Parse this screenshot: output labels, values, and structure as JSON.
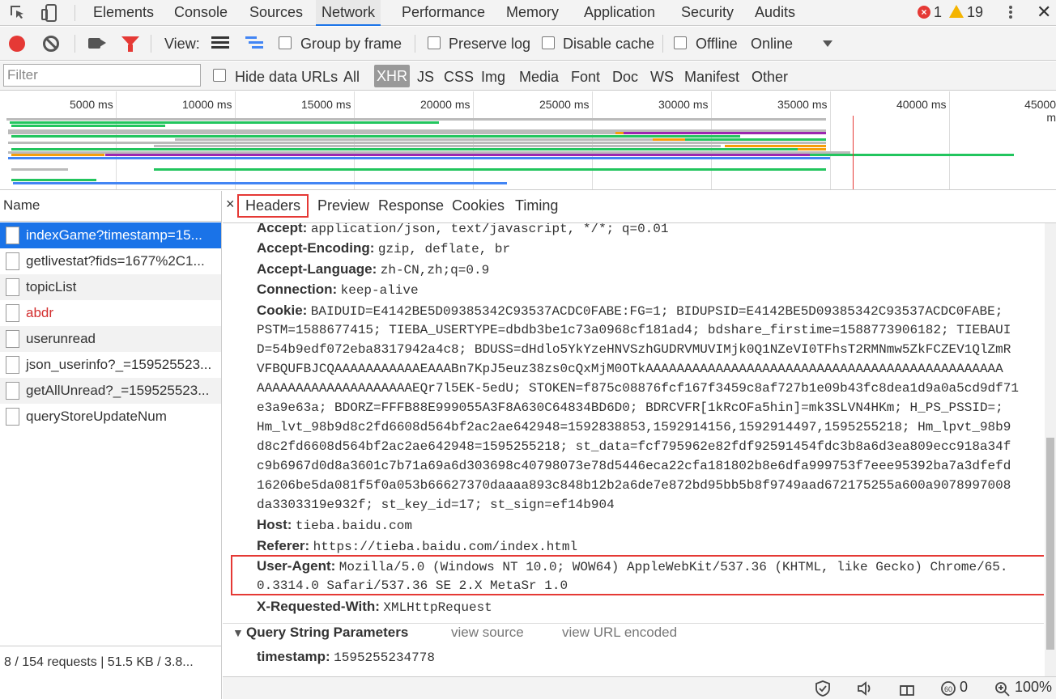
{
  "tabs": [
    {
      "label": "Elements"
    },
    {
      "label": "Console"
    },
    {
      "label": "Sources"
    },
    {
      "label": "Network"
    },
    {
      "label": "Performance"
    },
    {
      "label": "Memory"
    },
    {
      "label": "Application"
    },
    {
      "label": "Security"
    },
    {
      "label": "Audits"
    }
  ],
  "status_counts": {
    "errors": "1",
    "warnings": "19"
  },
  "toolbar": {
    "view_label": "View:",
    "group_by_frame": "Group by frame",
    "preserve_log": "Preserve log",
    "disable_cache": "Disable cache",
    "offline": "Offline",
    "throttle": "Online"
  },
  "filter": {
    "placeholder": "Filter",
    "hide_data_urls": "Hide data URLs",
    "types": [
      "All",
      "XHR",
      "JS",
      "CSS",
      "Img",
      "Media",
      "Font",
      "Doc",
      "WS",
      "Manifest",
      "Other"
    ],
    "active_type": "XHR"
  },
  "overview": {
    "ticks": [
      "5000 ms",
      "10000 ms",
      "15000 ms",
      "20000 ms",
      "25000 ms",
      "30000 ms",
      "35000 ms",
      "40000 ms",
      "45000 m"
    ]
  },
  "requests": {
    "column_header": "Name",
    "items": [
      {
        "name": "indexGame?timestamp=15...",
        "selected": true,
        "error": false
      },
      {
        "name": "getlivestat?fids=1677%2C1...",
        "selected": false,
        "error": false
      },
      {
        "name": "topicList",
        "selected": false,
        "error": false
      },
      {
        "name": "abdr",
        "selected": false,
        "error": true
      },
      {
        "name": "userunread",
        "selected": false,
        "error": false
      },
      {
        "name": "json_userinfo?_=159525523...",
        "selected": false,
        "error": false
      },
      {
        "name": "getAllUnread?_=159525523...",
        "selected": false,
        "error": false
      },
      {
        "name": "queryStoreUpdateNum",
        "selected": false,
        "error": false
      }
    ],
    "summary": "8 / 154 requests | 51.5 KB / 3.8..."
  },
  "detail": {
    "close": "×",
    "tabs": [
      "Headers",
      "Preview",
      "Response",
      "Cookies",
      "Timing"
    ],
    "active_tab": "Headers",
    "headers": {
      "accept_key": "Accept:",
      "accept_val": "application/json, text/javascript, */*; q=0.01",
      "accept_encoding_key": "Accept-Encoding:",
      "accept_encoding_val": "gzip, deflate, br",
      "accept_language_key": "Accept-Language:",
      "accept_language_val": "zh-CN,zh;q=0.9",
      "connection_key": "Connection:",
      "connection_val": "keep-alive",
      "cookie_key": "Cookie:",
      "cookie_lines": [
        "BAIDUID=E4142BE5D09385342C93537ACDC0FABE:FG=1; BIDUPSID=E4142BE5D09385342C93537ACDC0FABE;",
        "PSTM=1588677415; TIEBA_USERTYPE=dbdb3be1c73a0968cf181ad4; bdshare_firstime=1588773906182; TIEBAUI",
        "D=54b9edf072eba8317942a4c8; BDUSS=dHdlo5YkYzeHNVSzhGUDRVMUVIMjk0Q1NZeVI0TFhsT2RMNmw5ZkFCZEV1QlZmR",
        "VFBQUFBJCQAAAAAAAAAAAEAAABn7KpJ5euz38zs0cQxMjM0OTkAAAAAAAAAAAAAAAAAAAAAAAAAAAAAAAAAAAAAAAAAAAAAA",
        "AAAAAAAAAAAAAAAAAAAAEQr7l5EK-5edU; STOKEN=f875c08876fcf167f3459c8af727b1e09b43fc8dea1d9a0a5cd9df71",
        "e3a9e63a; BDORZ=FFFB88E999055A3F8A630C64834BD6D0; BDRCVFR[1kRcOFa5hin]=mk3SLVN4HKm; H_PS_PSSID=;",
        "Hm_lvt_98b9d8c2fd6608d564bf2ac2ae642948=1592838853,1592914156,1592914497,1595255218; Hm_lpvt_98b9",
        "d8c2fd6608d564bf2ac2ae642948=1595255218; st_data=fcf795962e82fdf92591454fdc3b8a6d3ea809ecc918a34f",
        "c9b6967d0d8a3601c7b71a69a6d303698c40798073e78d5446eca22cfa181802b8e6dfa999753f7eee95392ba7a3dfefd",
        "16206be5da081f5f0a053b66627370daaaa893c848b12b2a6de7e872bd95bb5b8f9749aad672175255a600a9078997008",
        "da3303319e932f; st_key_id=17; st_sign=ef14b904"
      ],
      "host_key": "Host:",
      "host_val": "tieba.baidu.com",
      "referer_key": "Referer:",
      "referer_val": "https://tieba.baidu.com/index.html",
      "ua_key": "User-Agent:",
      "ua_line1": "Mozilla/5.0 (Windows NT 10.0; WOW64) AppleWebKit/537.36 (KHTML, like Gecko) Chrome/65.",
      "ua_line2": "0.3314.0 Safari/537.36 SE 2.X MetaSr 1.0",
      "xrw_key": "X-Requested-With:",
      "xrw_val": "XMLHttpRequest"
    },
    "query_string": {
      "title": "Query String Parameters",
      "view_source": "view source",
      "view_url_encoded": "view URL encoded",
      "timestamp_key": "timestamp:",
      "timestamp_val": "1595255234778"
    }
  },
  "statusbar": {
    "count": "0",
    "zoom": "100%"
  },
  "colors": {
    "accent": "#1a73e8",
    "highlight": "#e53935"
  }
}
